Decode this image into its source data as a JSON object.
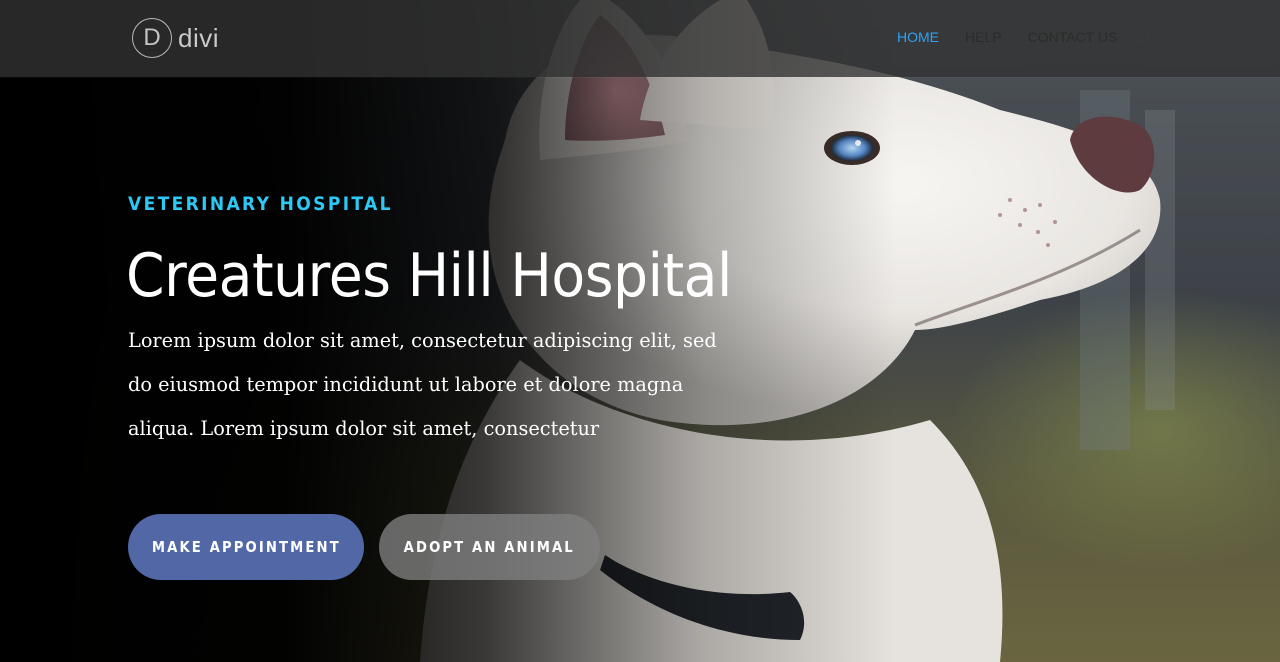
{
  "header": {
    "logo_letter": "D",
    "logo_text": "divi",
    "nav": [
      {
        "label": "HOME",
        "active": true
      },
      {
        "label": "HELP",
        "active": false
      },
      {
        "label": "CONTACT US",
        "active": false
      }
    ],
    "search_icon": "search-icon"
  },
  "hero": {
    "eyebrow": "VETERINARY HOSPITAL",
    "title": "Creatures Hill Hospital",
    "lead": "Lorem ipsum dolor sit amet, consectetur adipiscing elit, sed do eiusmod tempor incididunt ut labore et dolore magna aliqua. Lorem ipsum dolor sit amet, consectetur",
    "primary_button": "MAKE APPOINTMENT",
    "secondary_button": "ADOPT AN ANIMAL"
  },
  "colors": {
    "accent": "#2ec8f5",
    "nav_active": "#2ea3f2",
    "primary_button": "#5268a6"
  }
}
